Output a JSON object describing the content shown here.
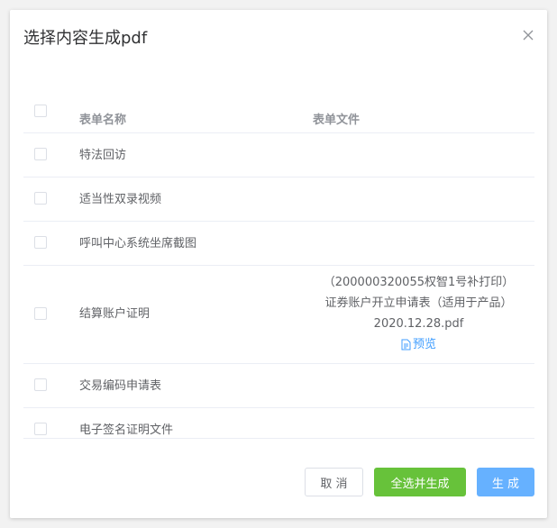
{
  "dialog": {
    "title": "选择内容生成pdf",
    "close_icon": "close-icon"
  },
  "table": {
    "headers": {
      "name": "表单名称",
      "file": "表单文件"
    },
    "rows": [
      {
        "name": "特法回访"
      },
      {
        "name": "适当性双录视频"
      },
      {
        "name": "呼叫中心系统坐席截图"
      },
      {
        "name": "结算账户证明",
        "file_lines": [
          "（200000320055权智1号补打印）",
          "证券账户开立申请表（适用于产品）",
          "2020.12.28.pdf"
        ],
        "preview_label": "预览",
        "preview_icon": "document-icon"
      },
      {
        "name": "交易编码申请表"
      },
      {
        "name": "电子签名证明文件"
      }
    ]
  },
  "footer": {
    "cancel_label": "取 消",
    "select_all_label": "全选并生成",
    "generate_label": "生 成"
  },
  "colors": {
    "primary": "#409eff",
    "success": "#67c23a",
    "primary_light": "#66b1ff"
  }
}
